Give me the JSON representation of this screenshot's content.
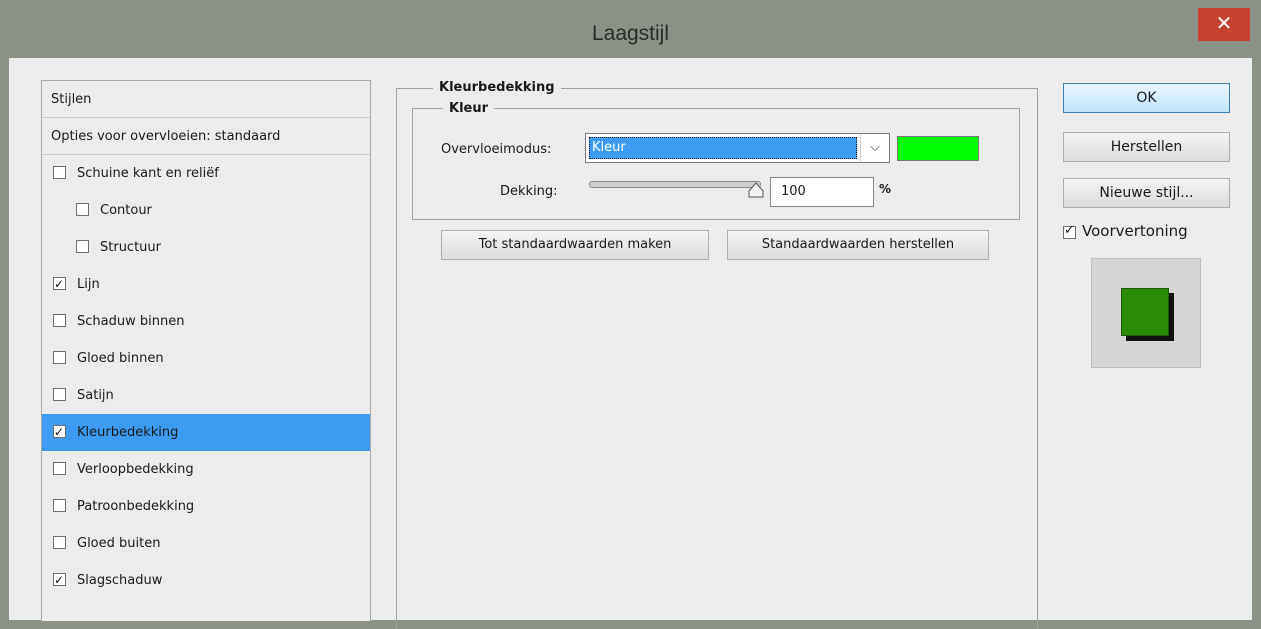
{
  "window": {
    "title": "Laagstijl",
    "close_label": "✕"
  },
  "style_list": {
    "header": "Stijlen",
    "blend_options": "Opties voor overvloeien: standaard",
    "items": [
      {
        "label": "Schuine kant en reliëf",
        "checked": false,
        "indent": false
      },
      {
        "label": "Contour",
        "checked": false,
        "indent": true
      },
      {
        "label": "Structuur",
        "checked": false,
        "indent": true
      },
      {
        "label": "Lijn",
        "checked": true,
        "indent": false
      },
      {
        "label": "Schaduw binnen",
        "checked": false,
        "indent": false
      },
      {
        "label": "Gloed binnen",
        "checked": false,
        "indent": false
      },
      {
        "label": "Satijn",
        "checked": false,
        "indent": false
      },
      {
        "label": "Kleurbedekking",
        "checked": true,
        "indent": false,
        "selected": true
      },
      {
        "label": "Verloopbedekking",
        "checked": false,
        "indent": false
      },
      {
        "label": "Patroonbedekking",
        "checked": false,
        "indent": false
      },
      {
        "label": "Gloed buiten",
        "checked": false,
        "indent": false
      },
      {
        "label": "Slagschaduw",
        "checked": true,
        "indent": false
      }
    ]
  },
  "panel": {
    "title": "Kleurbedekking",
    "group_title": "Kleur",
    "blend_mode_label": "Overvloeimodus:",
    "blend_mode_value": "Kleur",
    "color_swatch": "#00ff00",
    "opacity_label": "Dekking:",
    "opacity_value": "100",
    "opacity_unit": "%",
    "make_default_button": "Tot standaardwaarden maken",
    "reset_default_button": "Standaardwaarden herstellen"
  },
  "actions": {
    "ok": "OK",
    "reset": "Herstellen",
    "new_style": "Nieuwe stijl...",
    "preview_label": "Voorvertoning",
    "preview_checked": true,
    "preview_color": "#2a8a05"
  },
  "colors": {
    "accent": "#3d9cf1",
    "close": "#c8402f",
    "titlebar": "#8a9185"
  }
}
